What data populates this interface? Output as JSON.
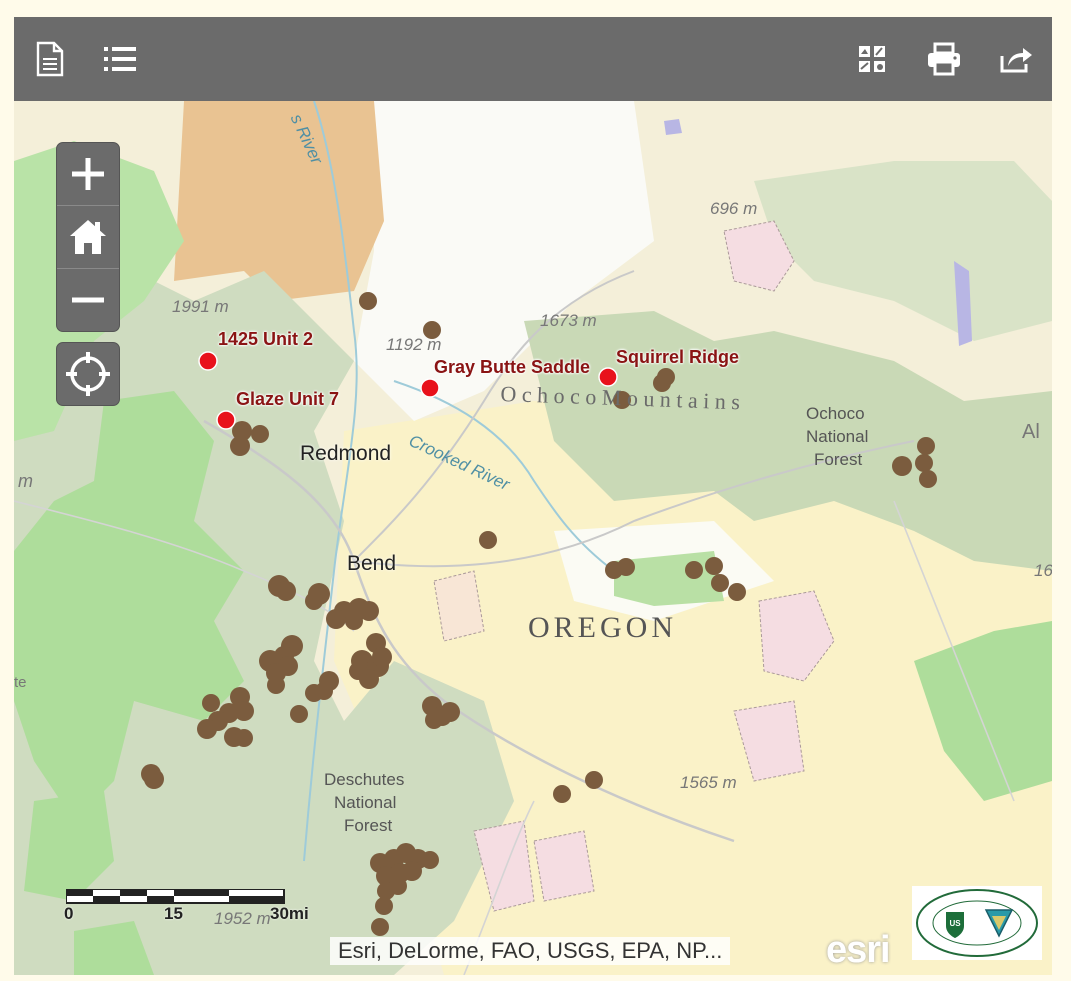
{
  "toolbar": {
    "buttons": [
      {
        "name": "details-icon",
        "tooltip": ""
      },
      {
        "name": "legend-list-icon",
        "tooltip": ""
      },
      {
        "name": "basemap-gallery-icon",
        "tooltip": ""
      },
      {
        "name": "print-icon",
        "tooltip": ""
      },
      {
        "name": "share-icon",
        "tooltip": ""
      }
    ]
  },
  "map_controls": {
    "zoom_in": "zoom-in-icon",
    "home": "home-icon",
    "zoom_out": "zoom-out-icon",
    "locate": "locate-icon"
  },
  "markers": [
    {
      "label": "1425 Unit 2"
    },
    {
      "label": "Glaze Unit 7"
    },
    {
      "label": "Gray Butte Saddle"
    },
    {
      "label": "Squirrel Ridge"
    }
  ],
  "marker_color": "#e8121c",
  "fire_dot_color": "#7b5c3e",
  "places": {
    "redmond": "Redmond",
    "bend": "Bend",
    "oregon": "OREGON",
    "crooked_river": "Crooked River",
    "ochoco_mountains": "O c h o c o   M o u n t a i n s",
    "ochoco_forest_1": "Ochoco",
    "ochoco_forest_2": "National",
    "ochoco_forest_3": "Forest",
    "deschutes_1": "Deschutes",
    "deschutes_2": "National",
    "deschutes_3": "Forest",
    "river_top": "s River",
    "edge_al": "Al",
    "edge_m": "m",
    "edge_16": "16",
    "edge_te": "te"
  },
  "elevations": {
    "e696": "696 m",
    "e1673": "1673 m",
    "e1192": "1192 m",
    "e1991": "1991 m",
    "e1565": "1565 m",
    "e1952": "1952 m"
  },
  "scalebar": {
    "zero": "0",
    "mid": "15",
    "end": "30mi"
  },
  "attribution": "Esri, DeLorme, FAO, USGS, EPA, NP...",
  "esri_logo": "esri",
  "org_logo_text": "CENTRAL OREGON FIRE MANAGEMENT SERVICE"
}
